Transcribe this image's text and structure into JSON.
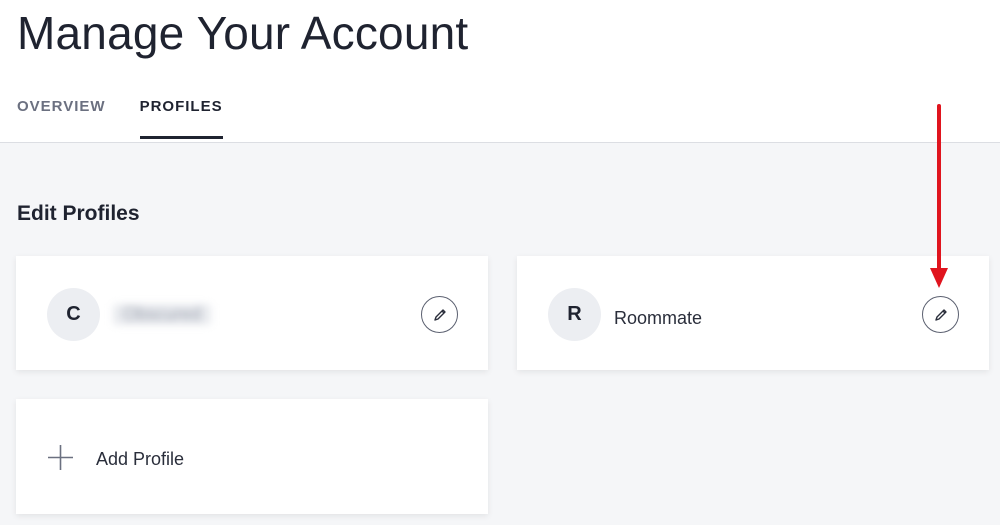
{
  "header": {
    "title": "Manage Your Account",
    "tabs": [
      {
        "label": "OVERVIEW",
        "active": false
      },
      {
        "label": "PROFILES",
        "active": true
      }
    ]
  },
  "main": {
    "section_title": "Edit Profiles",
    "profiles": [
      {
        "initial": "C",
        "name": "Obscured",
        "name_obscured": true,
        "edit_icon": "pencil-icon"
      },
      {
        "initial": "R",
        "name": "Roommate",
        "name_obscured": false,
        "edit_icon": "pencil-icon"
      }
    ],
    "add_profile_label": "Add Profile",
    "add_icon": "plus-icon"
  },
  "colors": {
    "background": "#f5f6f8",
    "text": "#1f2330",
    "muted_tab": "#6b7080",
    "annotation_arrow": "#e0141e"
  }
}
